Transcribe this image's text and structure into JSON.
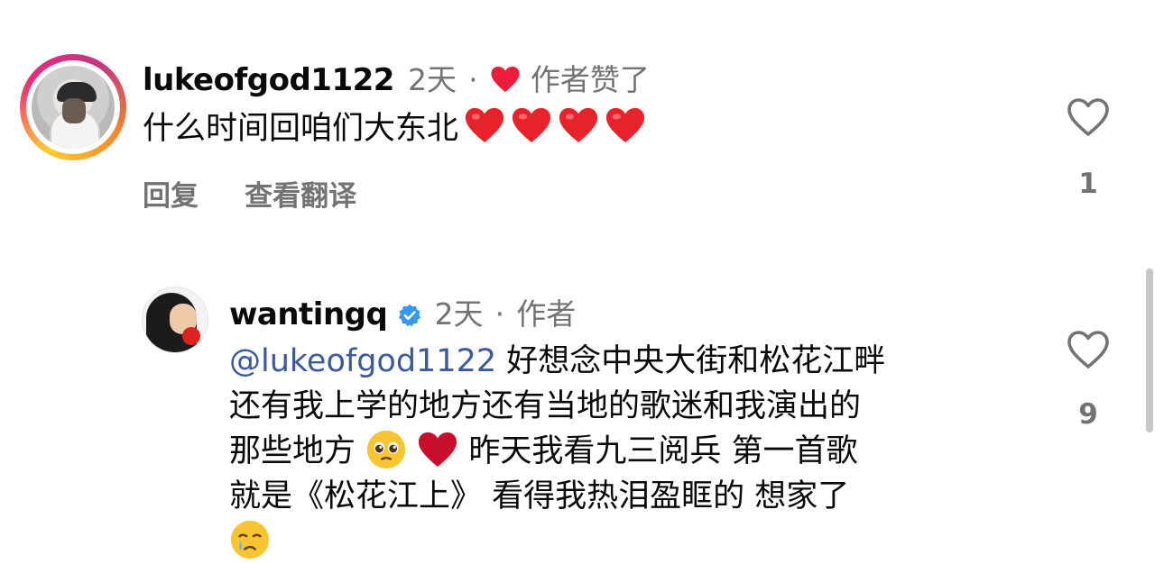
{
  "comment1": {
    "username": "lukeofgod1122",
    "time": "2天",
    "separator": "·",
    "author_liked": "作者赞了",
    "text": "什么时间回咱们大东北",
    "emoji": [
      "heart",
      "heart",
      "heart",
      "heart"
    ],
    "reply_label": "回复",
    "translate_label": "查看翻译",
    "like_count": "1"
  },
  "comment2": {
    "username": "wantingq",
    "verified": true,
    "time": "2天",
    "separator": "·",
    "author_label": "作者",
    "mention": "@lukeofgod1122",
    "line1": " 好想念中央大街和松花江畔",
    "line2": "还有我上学的地方还有当地的歌迷和我演出的",
    "line3_a": "那些地方",
    "line3_b": " 昨天我看九三阅兵 第一首歌",
    "line4": "就是《松花江上》 看得我热泪盈眶的 想家了",
    "emoji_line3": [
      "pleading-face",
      "heart"
    ],
    "emoji_line5": "crying-face",
    "like_count": "9"
  },
  "colors": {
    "like_heart": "#ed1c3a",
    "mention": "#3c5a9a",
    "meta": "#737373",
    "verified": "#3897f0"
  }
}
